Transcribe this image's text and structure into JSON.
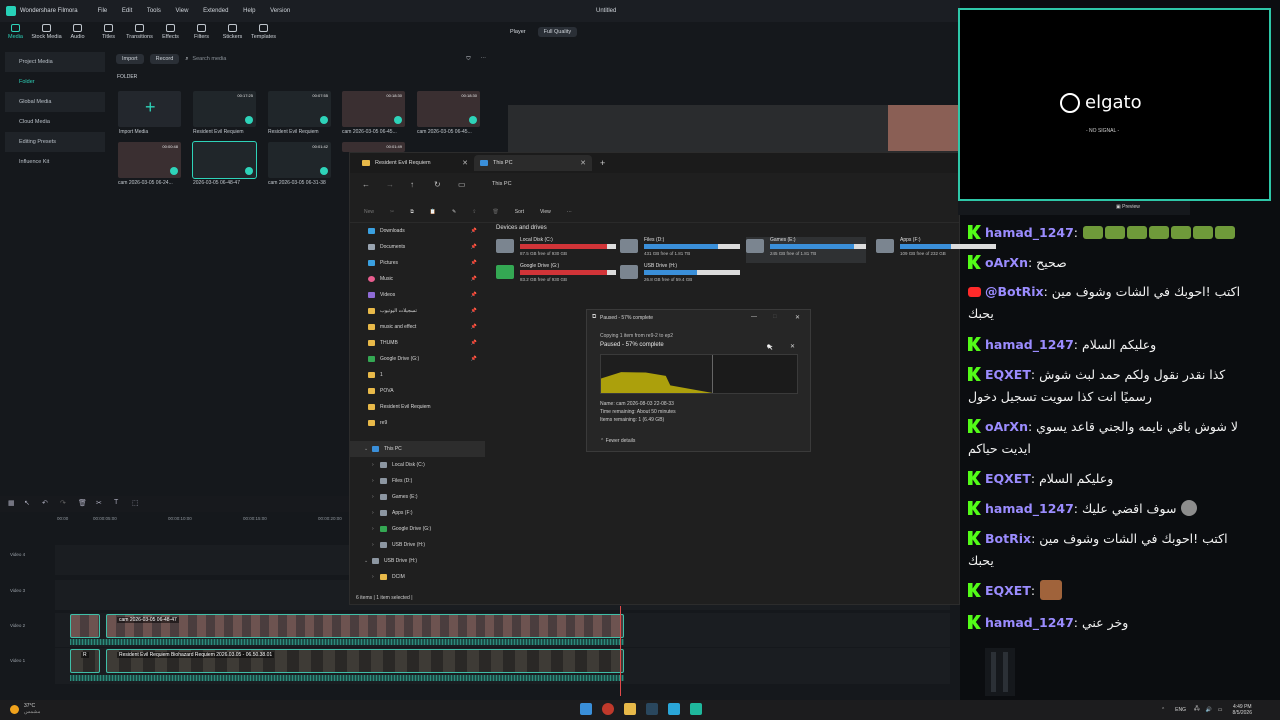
{
  "filmora": {
    "app_name": "Wondershare Filmora",
    "menu": [
      "File",
      "Edit",
      "Tools",
      "View",
      "Extended",
      "Help",
      "Version"
    ],
    "project_title": "Untitled",
    "toolbar": [
      "Media",
      "Stock Media",
      "Audio",
      "Titles",
      "Transitions",
      "Effects",
      "Filters",
      "Stickers",
      "Templates"
    ],
    "sidebar": [
      "Project Media",
      "Folder",
      "Global Media",
      "Cloud Media",
      "Editing Presets",
      "Influence Kit"
    ],
    "import_label": "Import",
    "record_label": "Record",
    "search_placeholder": "Search media",
    "folder_label": "FOLDER",
    "player_label": "Player",
    "quality_label": "Full Quality",
    "media": [
      {
        "caption": "Import Media",
        "duration": ""
      },
      {
        "caption": "Resident Evil Requiem",
        "duration": "00:17:25"
      },
      {
        "caption": "Resident Evil Requiem",
        "duration": "00:07:55"
      },
      {
        "caption": "cam 2026-03-05 06-45...",
        "duration": "00:18:30"
      },
      {
        "caption": "cam 2026-03-05 06-45...",
        "duration": "00:18:30"
      },
      {
        "caption": "cam 2026-03-05 06-24...",
        "duration": "00:00:48"
      },
      {
        "caption": "2026-03-05 06-48-47",
        "duration": ""
      },
      {
        "caption": "cam 2026-03-05 06-31-38",
        "duration": "00:01:42"
      },
      {
        "caption": "",
        "duration": "00:01:49"
      }
    ],
    "ruler": [
      "00:00",
      "00:00:05:00",
      "00:00:10:00",
      "00:00:15:00",
      "00:00:20:00",
      "00:00:25:00",
      "00:00:30:00",
      "00:00:35:00"
    ],
    "tracks": [
      "Video 4",
      "Video 3",
      "Video 2",
      "Video 1"
    ],
    "clip_video2": "cam 2026-03-05 06-48-47",
    "clip_video1_left": "R",
    "clip_video1": "Resident Evil Requiem Biohazard Requiem 2026.03.05 - 06.50.38.01"
  },
  "explorer": {
    "tabs": [
      "Resident Evil Requiem",
      "This PC"
    ],
    "path": "This PC",
    "commands": [
      "New",
      "Sort",
      "View"
    ],
    "nav": [
      {
        "label": "Downloads",
        "pinned": true
      },
      {
        "label": "Documents",
        "pinned": true
      },
      {
        "label": "Pictures",
        "pinned": true
      },
      {
        "label": "Music",
        "pinned": true
      },
      {
        "label": "Videos",
        "pinned": true
      },
      {
        "label": "تسجيلات اليوتيوب",
        "pinned": true
      },
      {
        "label": "music and effect",
        "pinned": true
      },
      {
        "label": "THUMB",
        "pinned": true
      },
      {
        "label": "Google Drive (G:)",
        "pinned": true
      },
      {
        "label": "1",
        "pinned": false
      },
      {
        "label": "POVA",
        "pinned": false
      },
      {
        "label": "Resident Evil Requiem",
        "pinned": false
      },
      {
        "label": "re9",
        "pinned": false
      }
    ],
    "tree": [
      "This PC",
      "Local Disk (C:)",
      "Files (D:)",
      "Games (E:)",
      "Apps (F:)",
      "Google Drive (G:)",
      "USB Drive (H:)",
      "USB Drive (H:)",
      "DCIM"
    ],
    "section_title": "Devices and drives",
    "drives": [
      {
        "name": "Local Disk (C:)",
        "free": "87.5 GB free of 930 GB",
        "used_fraction": 0.91,
        "color": "#d13438"
      },
      {
        "name": "Files (D:)",
        "free": "431 GB free of 1.81 TB",
        "used_fraction": 0.77,
        "color": "#3a8fd9"
      },
      {
        "name": "Games (E:)",
        "free": "245 GB free of 1.81 TB",
        "used_fraction": 0.87,
        "color": "#3a8fd9"
      },
      {
        "name": "Apps (F:)",
        "free": "109 GB free of 232 GB",
        "used_fraction": 0.53,
        "color": "#3a8fd9"
      },
      {
        "name": "Google Drive (G:)",
        "free": "83.2 GB free of 930 GB",
        "used_fraction": 0.91,
        "color": "#d13438"
      },
      {
        "name": "USB Drive (H:)",
        "free": "26.8 GB free of 59.4 GB",
        "used_fraction": 0.55,
        "color": "#3a8fd9"
      }
    ],
    "status": "6 items   |   1 item selected   |"
  },
  "copy_dialog": {
    "title": "Paused - 57% complete",
    "copying": "Copying 1 item from re9-2 to ep2",
    "status": "Paused - 57% complete",
    "progress": 0.57,
    "name": "Name: cam 2026-08-03 22-08-33",
    "time_remaining": "Time remaining: About 50 minutes",
    "items_remaining": "Items remaining: 1 (6.49 GB)",
    "fewer_details": "Fewer details"
  },
  "elgato": {
    "brand": "elgato",
    "status": "- NO SIGNAL -",
    "preview": "Preview"
  },
  "chat": [
    {
      "platform": "kick",
      "user": "hamad_1247",
      "text": "",
      "emotes": 7
    },
    {
      "platform": "kick",
      "user": "oArXn",
      "text": "صحيح"
    },
    {
      "platform": "youtube",
      "user": "@BotRix",
      "text": "اكتب !احوبك في الشات وشوف مين يحبك"
    },
    {
      "platform": "kick",
      "user": "hamad_1247",
      "text": "وعليكم السلام"
    },
    {
      "platform": "kick",
      "user": "EQXET",
      "text": "كذا نقدر نقول ولكم حمد لبث شوش رسميًا انت كذا سويت تسجيل دخول"
    },
    {
      "platform": "kick",
      "user": "oArXn",
      "text": "لا شوش باقي نايمه والجني قاعد يسوي ايديت حياكم"
    },
    {
      "platform": "kick",
      "user": "EQXET",
      "text": "وعليكم السلام"
    },
    {
      "platform": "kick",
      "user": "hamad_1247",
      "text": "سوف اقضي عليك"
    },
    {
      "platform": "kick",
      "user": "BotRix",
      "text": "اكتب !احوبك في الشات وشوف مين يحبك"
    },
    {
      "platform": "kick",
      "user": "EQXET",
      "text": ""
    },
    {
      "platform": "kick",
      "user": "hamad_1247",
      "text": "وخر عني"
    }
  ],
  "taskbar": {
    "temperature": "37°C",
    "weather": "مشمس",
    "lang": "ENG",
    "time": "4:49 PM",
    "date": "8/5/2026"
  }
}
